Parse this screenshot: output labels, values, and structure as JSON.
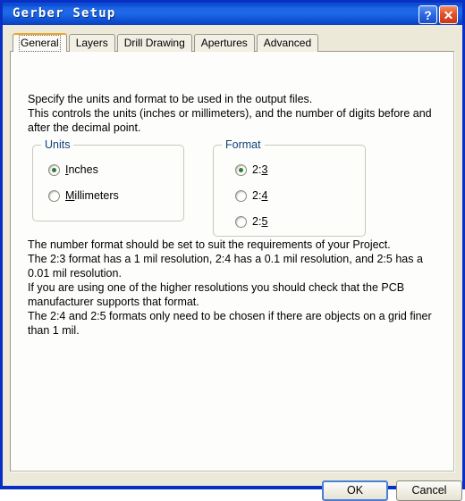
{
  "window": {
    "title": "Gerber Setup",
    "accent_title_bar": "#1f6ae8",
    "accent_border": "#0a2fc4",
    "background": "#ece9d8"
  },
  "titlebar_buttons": [
    {
      "name": "help-button",
      "glyph": "?"
    },
    {
      "name": "close-button",
      "glyph": "✕"
    }
  ],
  "tabs": [
    {
      "label": "General",
      "active": true
    },
    {
      "label": "Layers",
      "active": false
    },
    {
      "label": "Drill Drawing",
      "active": false
    },
    {
      "label": "Apertures",
      "active": false
    },
    {
      "label": "Advanced",
      "active": false
    }
  ],
  "general_tab": {
    "intro_text": "Specify the units and format to be used in the output files.\nThis controls the units (inches or millimeters), and the number of digits before and after the decimal point.",
    "units_group": {
      "title": "Units",
      "options": [
        {
          "label_before": "",
          "accel": "I",
          "label_after": "nches",
          "checked": true
        },
        {
          "label_before": "",
          "accel": "M",
          "label_after": "illimeters",
          "checked": false
        }
      ]
    },
    "format_group": {
      "title": "Format",
      "options": [
        {
          "label_before": "2:",
          "accel": "3",
          "label_after": "",
          "checked": true
        },
        {
          "label_before": "2:",
          "accel": "4",
          "label_after": "",
          "checked": false
        },
        {
          "label_before": "2:",
          "accel": "5",
          "label_after": "",
          "checked": false
        }
      ]
    },
    "notes_text": "The number format should be set to suit the requirements of your Project.\nThe 2:3 format has a 1 mil resolution, 2:4 has a 0.1 mil resolution, and 2:5 has a 0.01 mil resolution.\nIf you are using one of the higher resolutions you should check that the PCB manufacturer supports that format.\nThe 2:4 and 2:5 formats only need to be chosen if there are objects on a grid finer than 1 mil."
  },
  "footer": {
    "ok_label": "OK",
    "cancel_label": "Cancel"
  }
}
